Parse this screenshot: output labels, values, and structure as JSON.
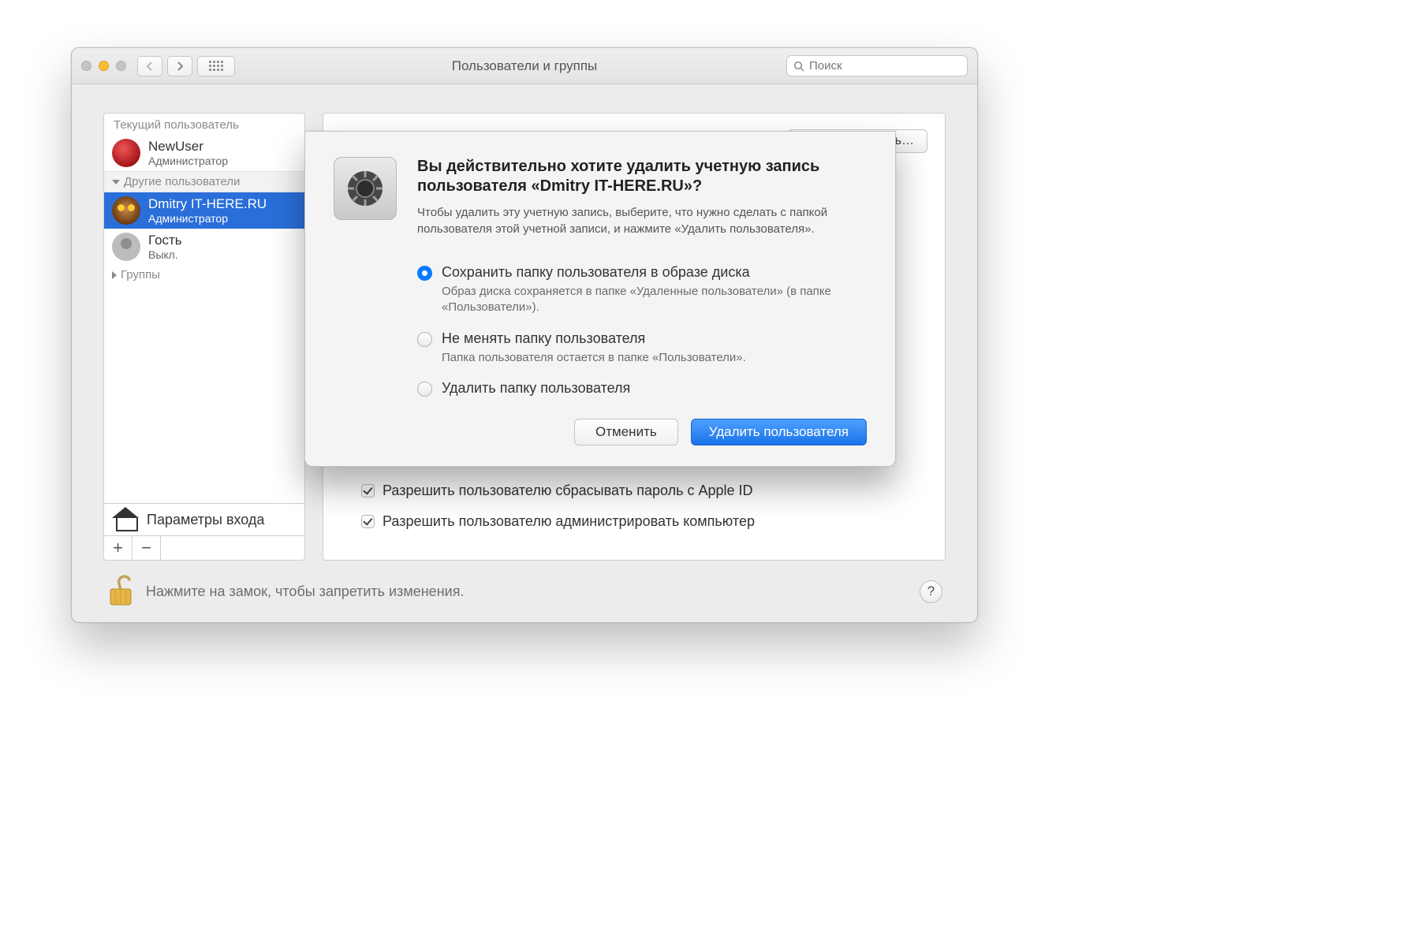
{
  "titlebar": {
    "title": "Пользователи и группы",
    "search_placeholder": "Поиск"
  },
  "sidebar": {
    "current_header": "Текущий пользователь",
    "other_header": "Другие пользователи",
    "groups_header": "Группы",
    "login_options": "Параметры входа",
    "users": [
      {
        "name": "NewUser",
        "role": "Администратор"
      },
      {
        "name": "Dmitry IT-HERE.RU",
        "role": "Администратор"
      },
      {
        "name": "Гость",
        "role": "Выкл."
      }
    ]
  },
  "main": {
    "reset_password_button": "Сбросить пароль…",
    "check_reset_appleid": "Разрешить пользователю сбрасывать пароль с Apple ID",
    "check_admin": "Разрешить пользователю администрировать компьютер"
  },
  "footer": {
    "lock_hint": "Нажмите на замок, чтобы запретить изменения."
  },
  "dialog": {
    "title": "Вы действительно хотите удалить учетную запись пользователя «Dmitry IT-HERE.RU»?",
    "description": "Чтобы удалить эту учетную запись, выберите, что нужно сделать с папкой пользователя этой учетной записи, и нажмите «Удалить пользователя».",
    "options": [
      {
        "label": "Сохранить папку пользователя в образе диска",
        "sub": "Образ диска сохраняется в папке «Удаленные пользователи» (в папке «Пользователи»).",
        "selected": true
      },
      {
        "label": "Не менять папку пользователя",
        "sub": "Папка пользователя остается в папке «Пользователи».",
        "selected": false
      },
      {
        "label": "Удалить папку пользователя",
        "sub": "",
        "selected": false
      }
    ],
    "cancel": "Отменить",
    "confirm": "Удалить пользователя"
  }
}
